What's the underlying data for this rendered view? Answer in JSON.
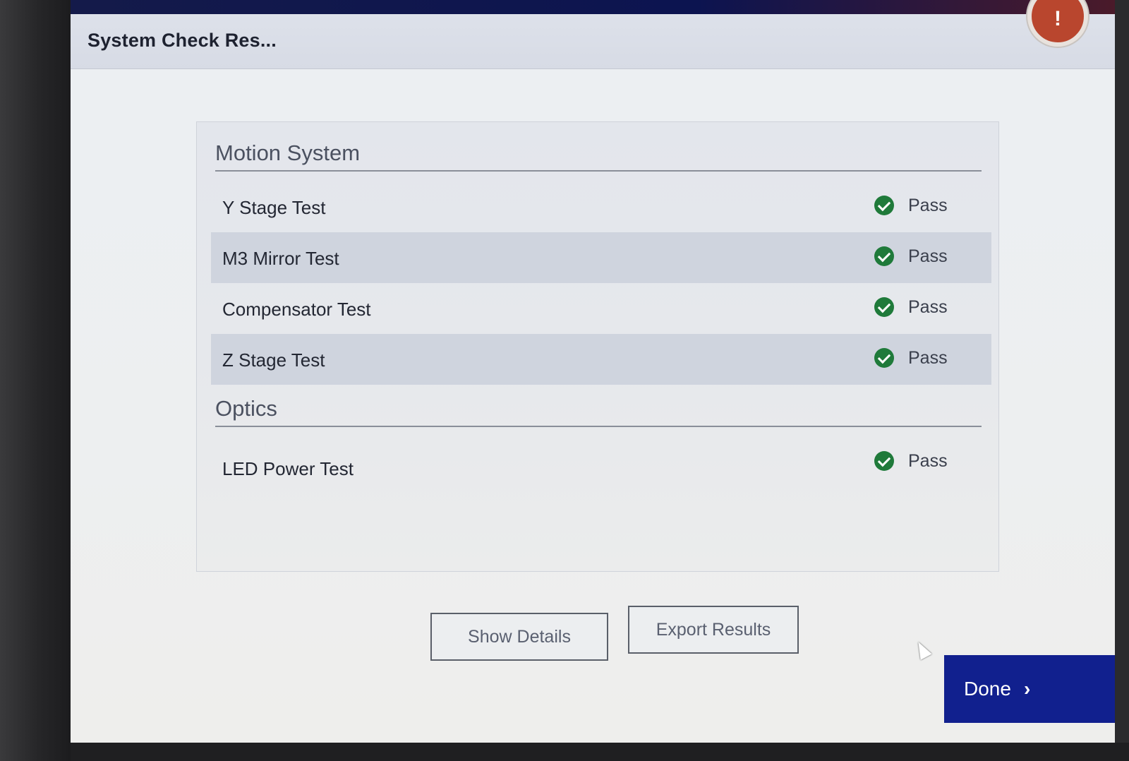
{
  "window": {
    "title": "System Check Res...",
    "alert_icon": "exclamation-icon",
    "alert_glyph": "!"
  },
  "sections": [
    {
      "label": "Motion System",
      "tests": [
        {
          "name": "Y Stage Test",
          "status": "Pass",
          "status_icon": "check-circle-icon"
        },
        {
          "name": "M3 Mirror Test",
          "status": "Pass",
          "status_icon": "check-circle-icon"
        },
        {
          "name": "Compensator Test",
          "status": "Pass",
          "status_icon": "check-circle-icon"
        },
        {
          "name": "Z Stage Test",
          "status": "Pass",
          "status_icon": "check-circle-icon"
        }
      ]
    },
    {
      "label": "Optics",
      "tests": [
        {
          "name": "LED Power Test",
          "status": "Pass",
          "status_icon": "check-circle-icon"
        }
      ]
    }
  ],
  "buttons": {
    "show_details": "Show Details",
    "export_results": "Export Results",
    "done": "Done",
    "done_icon": "chevron-right-icon",
    "done_glyph": "›"
  },
  "colors": {
    "pass_green": "#1f7a3a",
    "done_blue": "#11208e",
    "alert_red": "#b9462e"
  }
}
